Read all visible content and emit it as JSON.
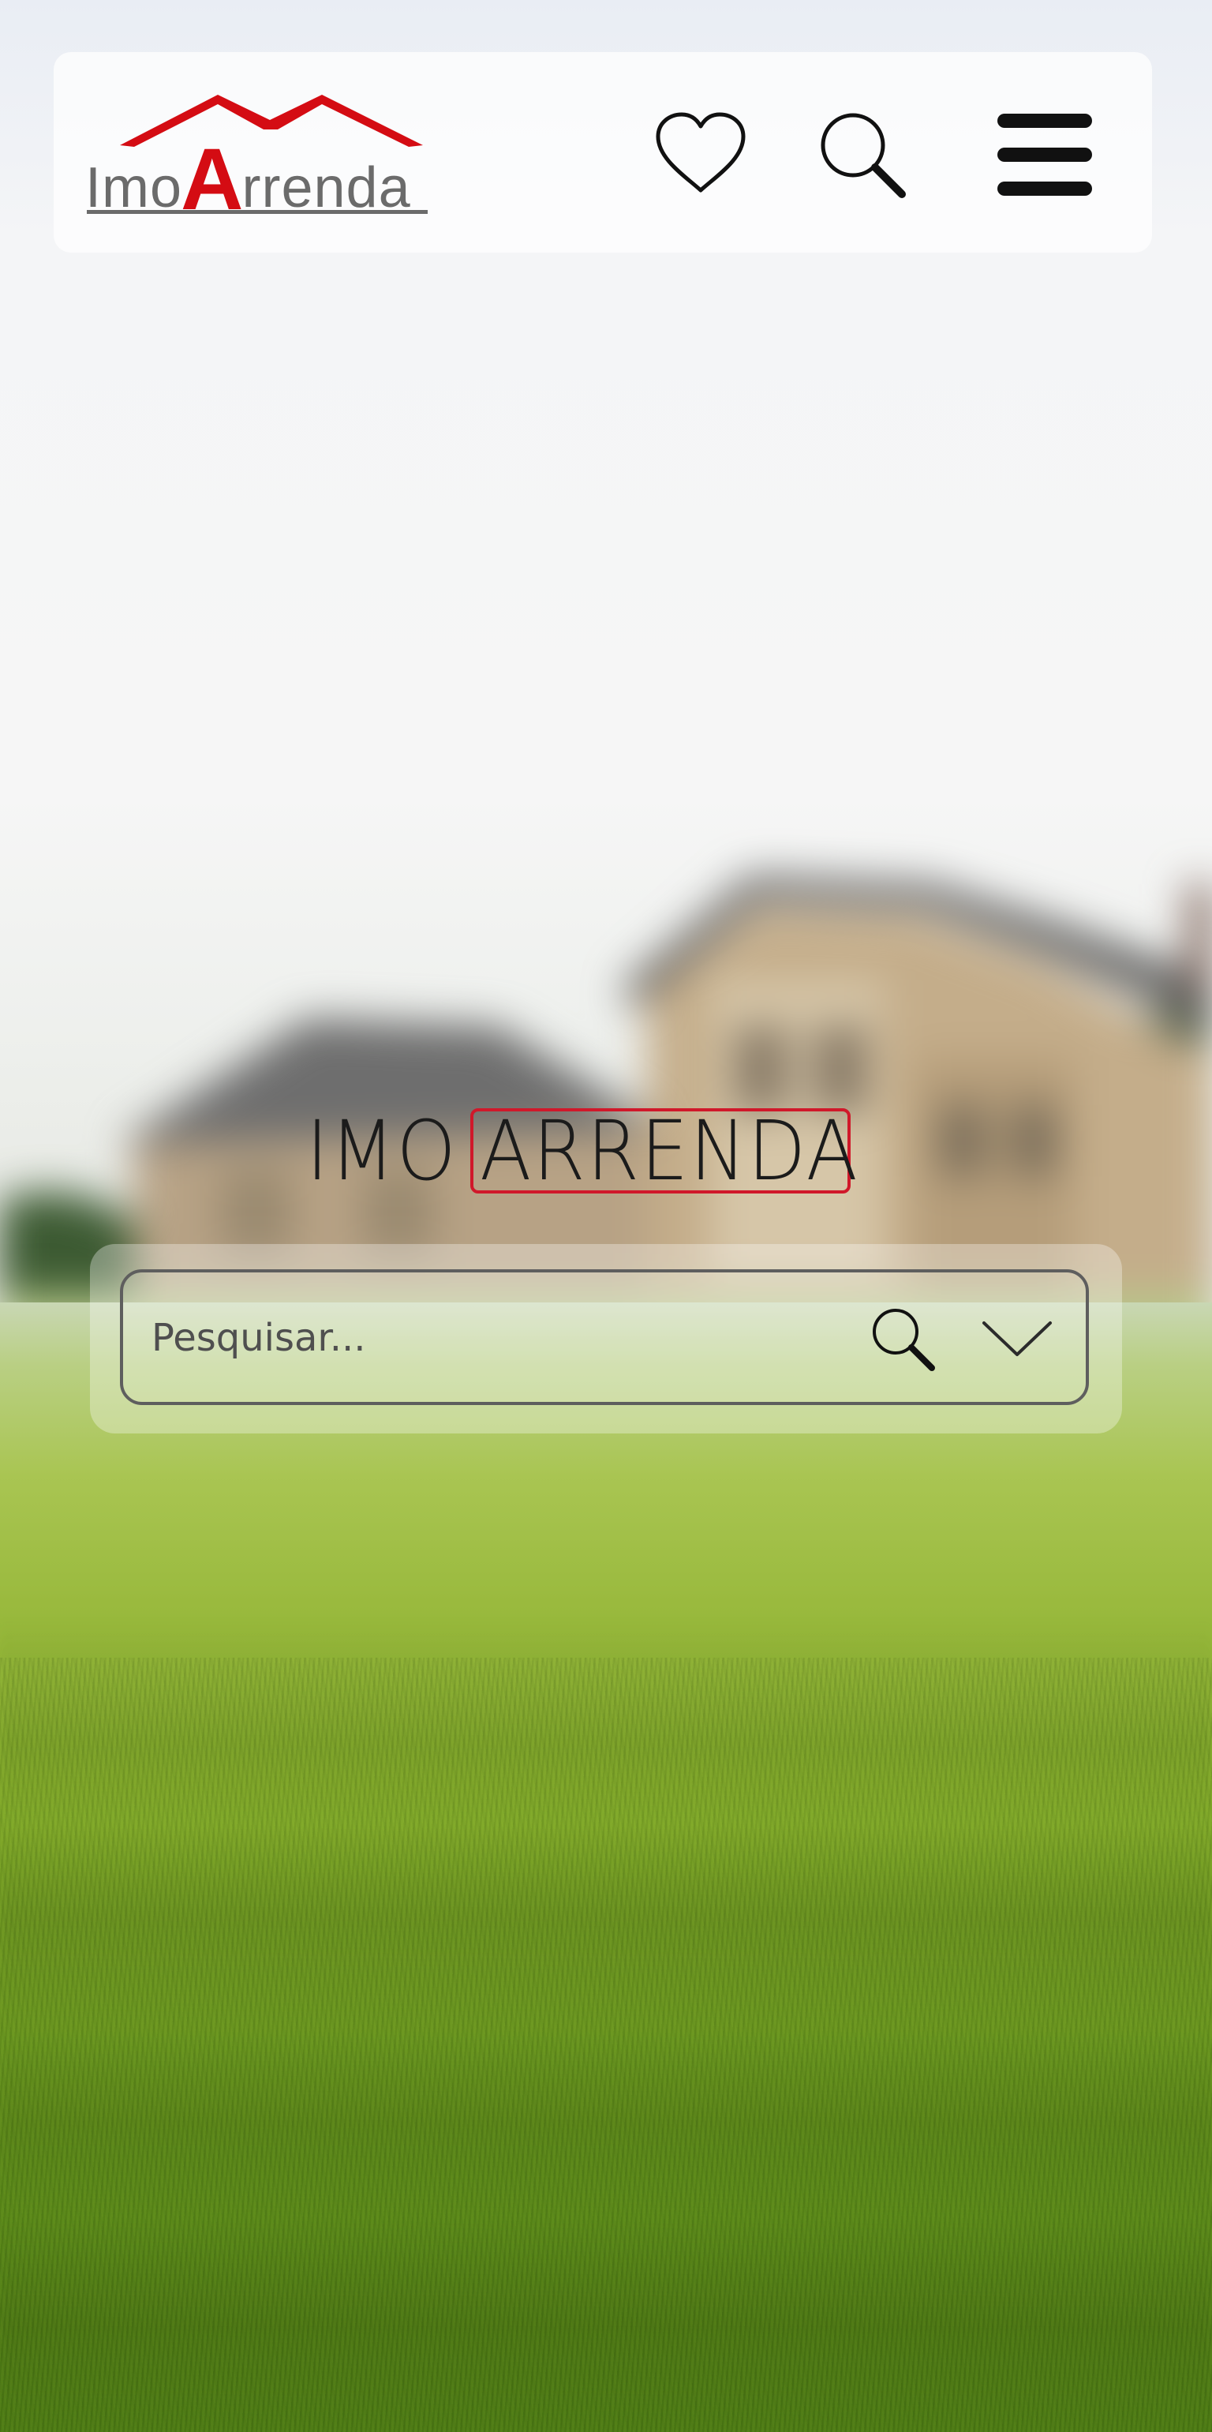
{
  "header": {
    "logo": {
      "prefix": "Imo",
      "highlight_letter": "A",
      "suffix": "rrenda",
      "brand_color": "#d40c13",
      "text_color": "#6b6b6b"
    },
    "icons": {
      "favorites": "heart-icon",
      "search": "search-icon",
      "menu": "hamburger-menu-icon"
    }
  },
  "hero": {
    "brand_prefix": "IMO",
    "brand_boxed": "ARRENDA",
    "brand_box_color": "#d0182a",
    "search": {
      "placeholder": "Pesquisar...",
      "value": "",
      "submit_icon": "search-icon",
      "dropdown_icon": "chevron-down-icon"
    }
  },
  "background": {
    "description_colors": {
      "sky": "#f4f5f7",
      "grass": "#86ad2c"
    }
  }
}
